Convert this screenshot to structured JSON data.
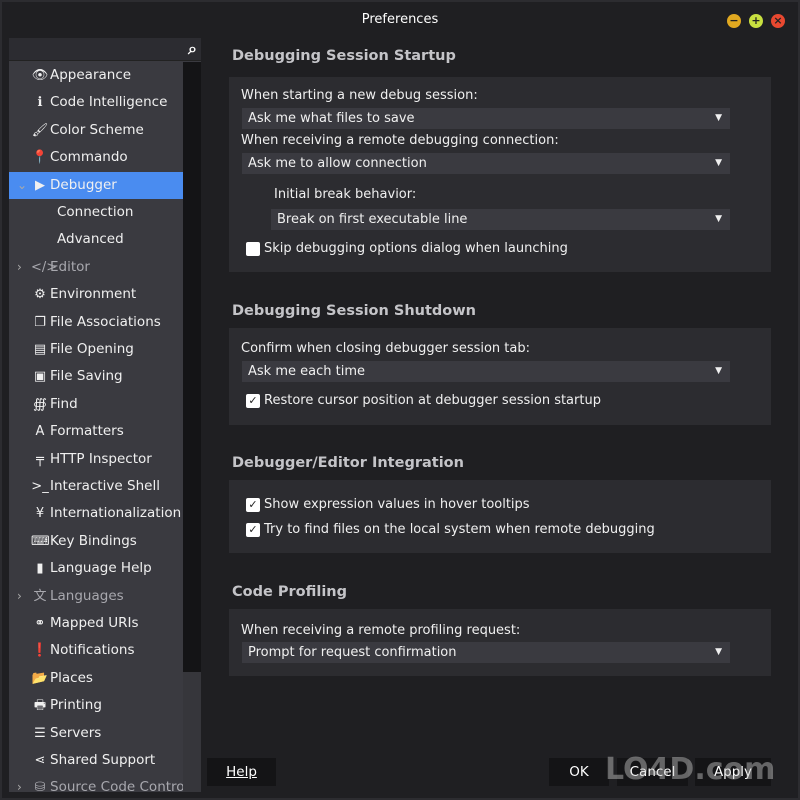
{
  "window": {
    "title": "Preferences",
    "controls": [
      "minimize",
      "maximize",
      "close"
    ]
  },
  "sidebar": {
    "search_placeholder": "",
    "items": [
      {
        "label": "Appearance",
        "icon": "eye-icon",
        "glyph": "👁"
      },
      {
        "label": "Code Intelligence",
        "icon": "info-icon",
        "glyph": "ℹ"
      },
      {
        "label": "Color Scheme",
        "icon": "brush-icon",
        "glyph": "🖌"
      },
      {
        "label": "Commando",
        "icon": "pin-icon",
        "glyph": "📍"
      },
      {
        "label": "Debugger",
        "icon": "play-icon",
        "glyph": "▶",
        "expanded": true,
        "selected": true
      },
      {
        "label": "Connection",
        "sub": true
      },
      {
        "label": "Advanced",
        "sub": true
      },
      {
        "label": "Editor",
        "icon": "code-icon",
        "glyph": "</>",
        "collapsed": true
      },
      {
        "label": "Environment",
        "icon": "gear-icon",
        "glyph": "⚙"
      },
      {
        "label": "File Associations",
        "icon": "files-icon",
        "glyph": "❐"
      },
      {
        "label": "File Opening",
        "icon": "file-icon",
        "glyph": "▤"
      },
      {
        "label": "File Saving",
        "icon": "save-icon",
        "glyph": "▣"
      },
      {
        "label": "Find",
        "icon": "binoculars-icon",
        "glyph": "∰"
      },
      {
        "label": "Formatters",
        "icon": "font-icon",
        "glyph": "A"
      },
      {
        "label": "HTTP Inspector",
        "icon": "signpost-icon",
        "glyph": "╤"
      },
      {
        "label": "Interactive Shell",
        "icon": "terminal-icon",
        "glyph": ">_"
      },
      {
        "label": "Internationalization",
        "icon": "yen-icon",
        "glyph": "¥"
      },
      {
        "label": "Key Bindings",
        "icon": "keyboard-icon",
        "glyph": "⌨"
      },
      {
        "label": "Language Help",
        "icon": "book-icon",
        "glyph": "▮"
      },
      {
        "label": "Languages",
        "icon": "language-icon",
        "glyph": "文",
        "collapsed": true
      },
      {
        "label": "Mapped URIs",
        "icon": "link-icon",
        "glyph": "⚭"
      },
      {
        "label": "Notifications",
        "icon": "alert-icon",
        "glyph": "❗"
      },
      {
        "label": "Places",
        "icon": "folder-icon",
        "glyph": "📂"
      },
      {
        "label": "Printing",
        "icon": "printer-icon",
        "glyph": "🖶"
      },
      {
        "label": "Servers",
        "icon": "server-icon",
        "glyph": "☰"
      },
      {
        "label": "Shared Support",
        "icon": "share-icon",
        "glyph": "⋖"
      },
      {
        "label": "Source Code Control",
        "icon": "database-icon",
        "glyph": "⛁",
        "collapsed": true
      }
    ]
  },
  "sections": {
    "startup": {
      "title": "Debugging Session Startup",
      "new_session_label": "When starting a new debug session:",
      "new_session_value": "Ask me what files to save",
      "remote_label": "When receiving a remote debugging connection:",
      "remote_value": "Ask me to allow connection",
      "break_label": "Initial break behavior:",
      "break_value": "Break on first executable line",
      "skip_label": "Skip debugging options dialog when launching",
      "skip_checked": false
    },
    "shutdown": {
      "title": "Debugging Session Shutdown",
      "confirm_label": "Confirm when closing debugger session tab:",
      "confirm_value": "Ask me each time",
      "restore_label": "Restore cursor position at debugger session startup",
      "restore_checked": true
    },
    "integration": {
      "title": "Debugger/Editor Integration",
      "hover_label": "Show expression values in hover tooltips",
      "hover_checked": true,
      "find_label": "Try to find files on the local system when remote debugging",
      "find_checked": true
    },
    "profiling": {
      "title": "Code Profiling",
      "request_label": "When receiving a remote profiling request:",
      "request_value": "Prompt for request confirmation"
    }
  },
  "buttons": {
    "help": "Help",
    "ok": "OK",
    "cancel": "Cancel",
    "apply": "Apply"
  },
  "watermark": "LO4D.com",
  "colors": {
    "accent": "#4a8cf0",
    "background": "#1f1f22",
    "panel": "#2c2c30",
    "minimize": "#e0a820",
    "maximize": "#c8e040",
    "close": "#e84830"
  }
}
